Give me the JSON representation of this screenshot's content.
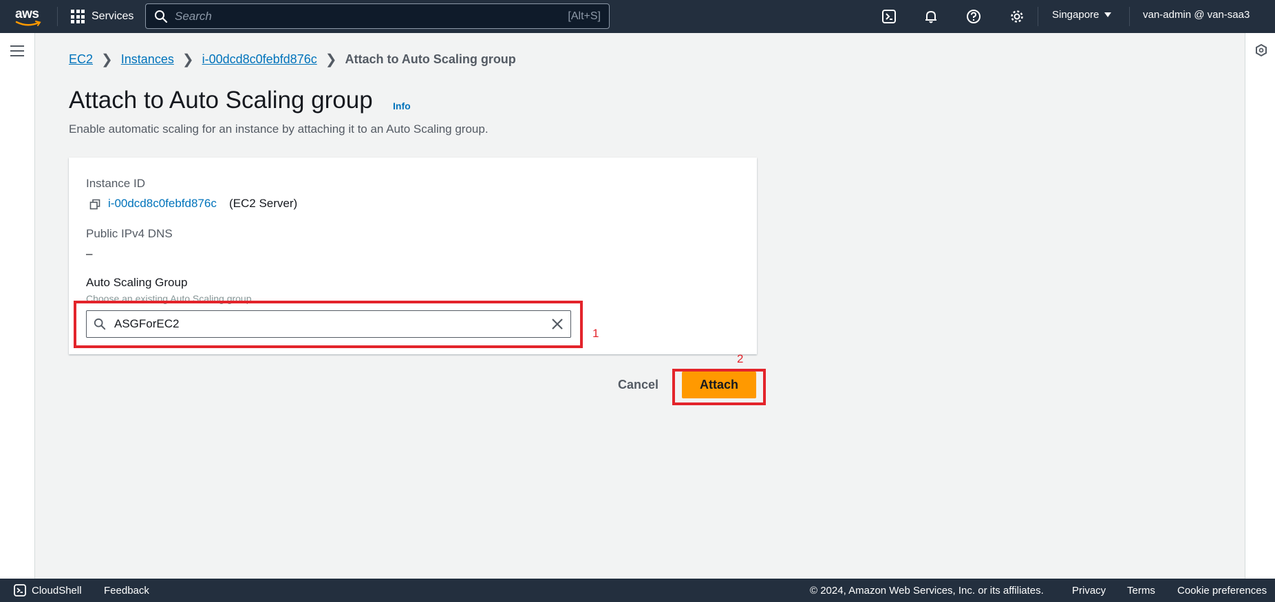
{
  "nav": {
    "logo_text": "aws",
    "services_label": "Services",
    "search_placeholder": "Search",
    "search_shortcut": "[Alt+S]",
    "region": "Singapore",
    "account": "van-admin @ van-saa3"
  },
  "breadcrumb": {
    "items": [
      "EC2",
      "Instances",
      "i-00dcd8c0febfd876c"
    ],
    "current": "Attach to Auto Scaling group"
  },
  "page": {
    "title": "Attach to Auto Scaling group",
    "info_label": "Info",
    "description": "Enable automatic scaling for an instance by attaching it to an Auto Scaling group."
  },
  "form": {
    "instance_id_label": "Instance ID",
    "instance_id": "i-00dcd8c0febfd876c",
    "instance_name": "(EC2 Server)",
    "dns_label": "Public IPv4 DNS",
    "dns_value": "–",
    "asg_label": "Auto Scaling Group",
    "asg_hint": "Choose an existing Auto Scaling group",
    "asg_value": "ASGForEC2"
  },
  "actions": {
    "cancel_label": "Cancel",
    "attach_label": "Attach"
  },
  "annotations": [
    "1",
    "2"
  ],
  "footer": {
    "cloudshell_label": "CloudShell",
    "feedback_label": "Feedback",
    "copyright": "© 2024, Amazon Web Services, Inc. or its affiliates.",
    "privacy_label": "Privacy",
    "terms_label": "Terms",
    "cookie_label": "Cookie preferences"
  },
  "colors": {
    "nav_bg": "#232f3e",
    "link": "#0073bb",
    "primary_button": "#ff9900",
    "annotation": "#e3242b"
  },
  "icons": [
    "aws-logo",
    "grid-icon",
    "search-icon",
    "cloudshell-icon",
    "bell-icon",
    "help-icon",
    "gear-icon",
    "caret-down-icon",
    "hamburger-icon",
    "hexagon-icon",
    "copy-icon",
    "clear-icon"
  ]
}
